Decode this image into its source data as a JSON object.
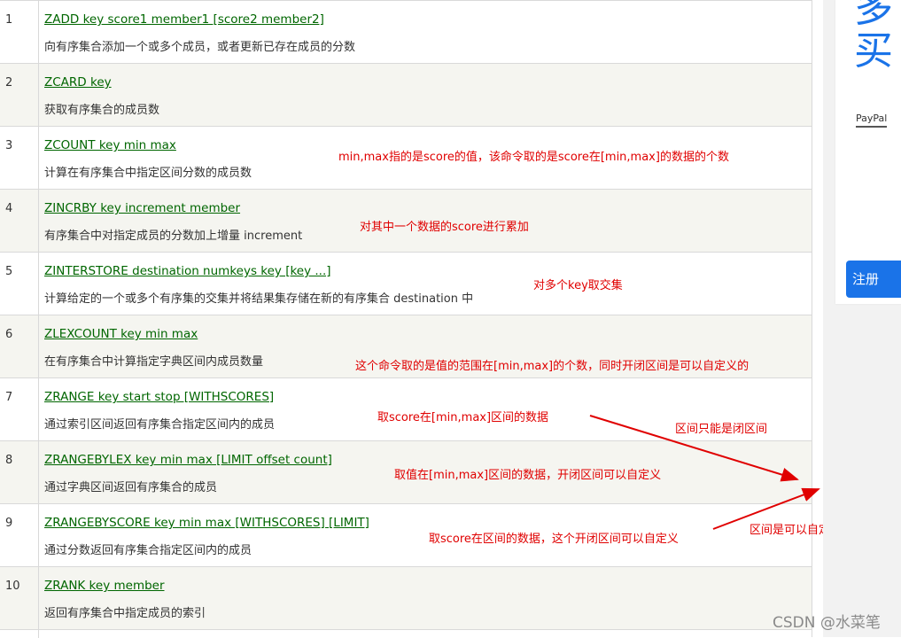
{
  "rows": [
    {
      "num": "1",
      "cmd": "ZADD key score1 member1 [score2 member2]",
      "desc": "向有序集合添加一个或多个成员，或者更新已存在成员的分数"
    },
    {
      "num": "2",
      "cmd": "ZCARD key",
      "desc": "获取有序集合的成员数"
    },
    {
      "num": "3",
      "cmd": "ZCOUNT key min max",
      "desc": "计算在有序集合中指定区间分数的成员数"
    },
    {
      "num": "4",
      "cmd": "ZINCRBY key increment member",
      "desc": "有序集合中对指定成员的分数加上增量 increment"
    },
    {
      "num": "5",
      "cmd": "ZINTERSTORE destination numkeys key [key ...]",
      "desc": "计算给定的一个或多个有序集的交集并将结果集存储在新的有序集合 destination 中"
    },
    {
      "num": "6",
      "cmd": "ZLEXCOUNT key min max",
      "desc": "在有序集合中计算指定字典区间内成员数量"
    },
    {
      "num": "7",
      "cmd": "ZRANGE key start stop [WITHSCORES]",
      "desc": "通过索引区间返回有序集合指定区间内的成员"
    },
    {
      "num": "8",
      "cmd": "ZRANGEBYLEX key min max [LIMIT offset count]",
      "desc": "通过字典区间返回有序集合的成员"
    },
    {
      "num": "9",
      "cmd": "ZRANGEBYSCORE key min max [WITHSCORES] [LIMIT]",
      "desc": "通过分数返回有序集合指定区间内的成员"
    },
    {
      "num": "10",
      "cmd": "ZRANK key member",
      "desc": "返回有序集合中指定成员的索引"
    }
  ],
  "notes": {
    "zcount": "min,max指的是score的值，该命令取的是score在[min,max]的数据的个数",
    "zincrby": "对其中一个数据的score进行累加",
    "zinterstore": "对多个key取交集",
    "zlexcount": "这个命令取的是值的范围在[min,max]的个数，同时开闭区间是可以自定义的",
    "zrange": "取score在[min,max]区间的数据",
    "closed_only": "区间只能是闭区间",
    "zrangebylex": "取值在[min,max]区间的数据，开闭区间可以自定义",
    "zrangebyscore": "取score在区间的数据，这个开闭区间可以自定义",
    "custom_interval": "区间是可以自定义的"
  },
  "sidebar": {
    "big_line1": "多",
    "big_line2": "买",
    "paypal": "PayPal",
    "register": "注册"
  },
  "watermark": "CSDN @水菜笔",
  "colors": {
    "link": "#006600",
    "annotation": "#e00000",
    "accent": "#1a73e8"
  }
}
